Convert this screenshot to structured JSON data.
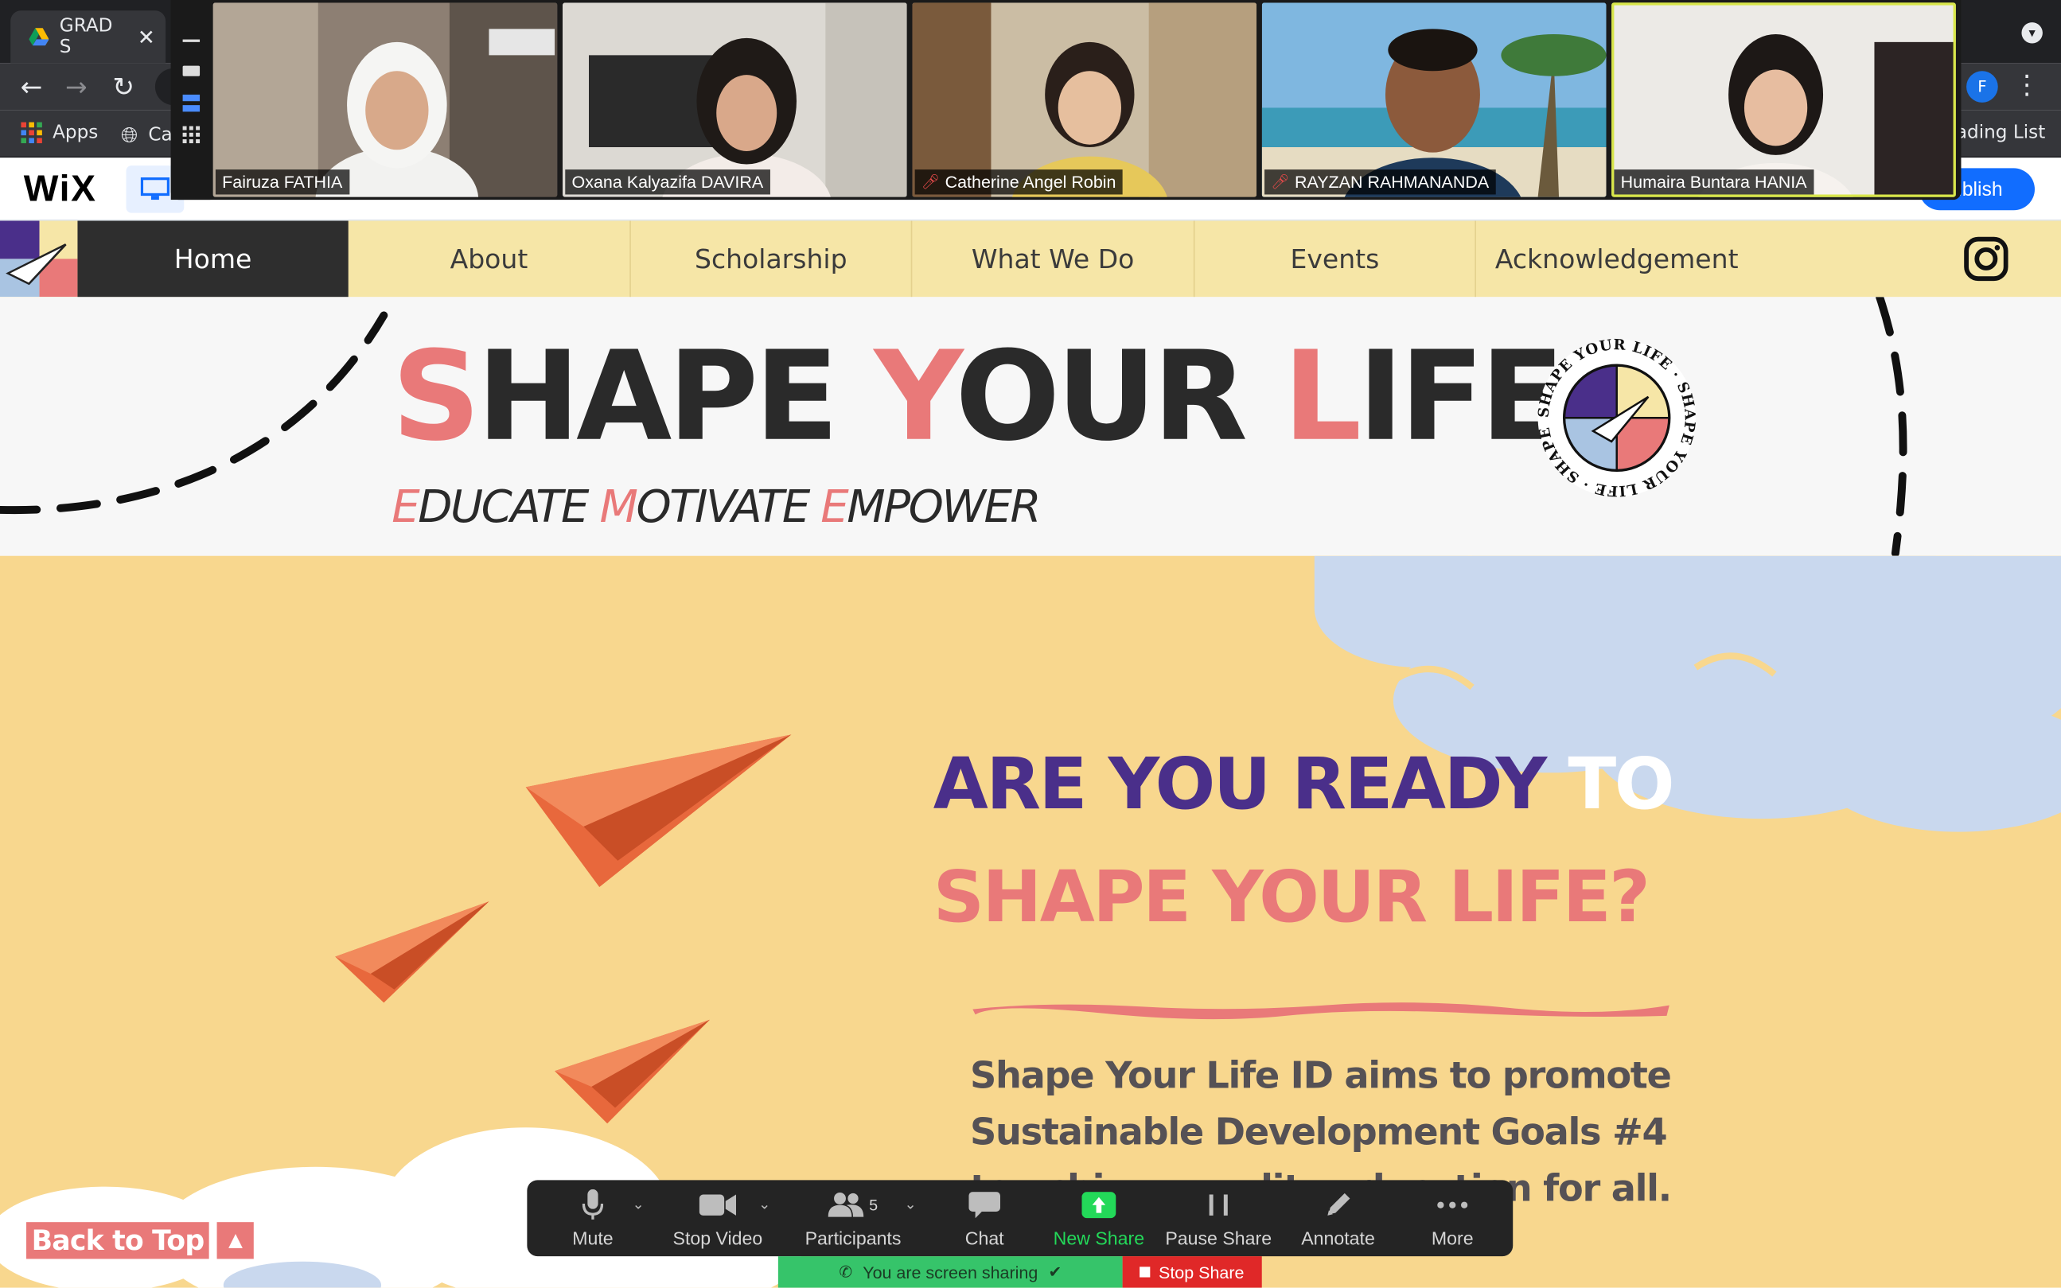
{
  "browser": {
    "tab_title": "GRAD S",
    "tab_close": "✕",
    "bookmarks": {
      "apps": "Apps",
      "second": "Ca",
      "reading_list": "ading List"
    },
    "profile_initial": "F"
  },
  "wix_editor": {
    "logo": "WiX",
    "publish_label": "ublish"
  },
  "zoom_participants": [
    {
      "name": "Fairuza FATHIA",
      "muted": false
    },
    {
      "name": "Oxana Kalyazifa DAVIRA",
      "muted": false
    },
    {
      "name": "Catherine Angel Robin",
      "muted": true
    },
    {
      "name": "RAYZAN RAHMANANDA",
      "muted": true
    },
    {
      "name": "Humaira Buntara HANIA",
      "muted": false,
      "active_speaker": true
    }
  ],
  "site_nav": {
    "items": [
      "Home",
      "About",
      "Scholarship",
      "What We Do",
      "Events",
      "Acknowledgement"
    ],
    "active": "Home"
  },
  "hero": {
    "title_parts": [
      "S",
      "HAPE ",
      "Y",
      "OUR ",
      "L",
      "IFE"
    ],
    "tagline_parts": [
      "E",
      "DUCATE ",
      "M",
      "OTIVATE ",
      "E",
      "MPOWER"
    ],
    "badge_text": "SHAPE YOUR LIFE · SHAPE YOUR LIFE · SHAPE YOUR LIFE ·"
  },
  "main": {
    "question_line1": "ARE YOU READY ",
    "question_line1_white": "TO",
    "question_line2": "SHAPE YOUR LIFE?",
    "description": "Shape Your Life ID aims to promote Sustainable Development Goals #4 to achieve quality education for all.",
    "back_to_top": "Back to Top"
  },
  "zoom_toolbar": {
    "mute": "Mute",
    "stop_video": "Stop Video",
    "participants": "Participants",
    "participants_count": "5",
    "chat": "Chat",
    "new_share": "New Share",
    "pause_share": "Pause Share",
    "annotate": "Annotate",
    "more": "More",
    "sharing_status": "You are screen sharing",
    "stop_share": "Stop Share"
  },
  "colors": {
    "accent_pink": "#e97979",
    "purple": "#4a2f8a",
    "nav_yellow": "#f6e6a7",
    "section_yellow": "#f8d78e",
    "zoom_green": "#23d959"
  }
}
